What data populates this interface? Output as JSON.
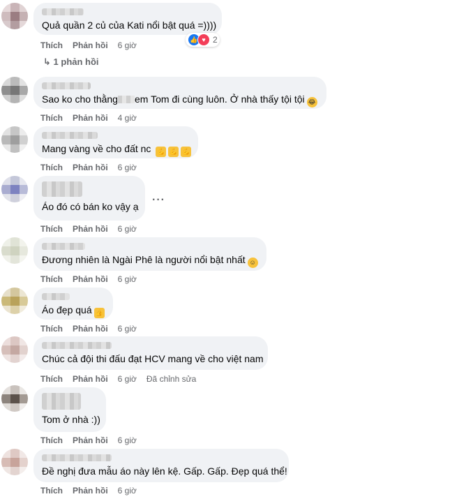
{
  "comments": [
    {
      "text": "Quả quần 2 củ của Kati nổi bật quá =))))",
      "like": "Thích",
      "reply": "Phản hồi",
      "time": "6 giờ",
      "reaction_count": "2",
      "replies_label": "1 phản hồi"
    },
    {
      "text_before": "Sao ko cho thằng",
      "text_after": "em Tom đi cùng luôn. Ở nhà thấy tội tội",
      "like": "Thích",
      "reply": "Phản hồi",
      "time": "4 giờ",
      "emoji": "rofl"
    },
    {
      "text": "Mang vàng về cho đất nc",
      "like": "Thích",
      "reply": "Phản hồi",
      "time": "6 giờ",
      "emoji": "flexed-biceps x3"
    },
    {
      "text": "Áo đó có bán ko vậy ạ",
      "like": "Thích",
      "reply": "Phản hồi",
      "time": "6 giờ"
    },
    {
      "text": "Đương nhiên là Ngài Phê là người nổi bật nhất",
      "like": "Thích",
      "reply": "Phản hồi",
      "time": "6 giờ",
      "emoji": "smile"
    },
    {
      "text": "Áo đẹp quá",
      "like": "Thích",
      "reply": "Phản hồi",
      "time": "6 giờ",
      "emoji": "thumbs-up"
    },
    {
      "text": "Chúc cả đội thi đấu đạt HCV mang về cho việt nam",
      "like": "Thích",
      "reply": "Phản hồi",
      "time": "6 giờ",
      "edited": "Đã chỉnh sửa"
    },
    {
      "text": "Tom ở nhà :))",
      "like": "Thích",
      "reply": "Phản hồi",
      "time": "6 giờ"
    },
    {
      "text": "Đề nghị đưa mẫu áo này lên kệ. Gấp. Gấp. Đẹp quá thể!",
      "like": "Thích",
      "reply": "Phản hồi",
      "time": "6 giờ"
    }
  ],
  "colors": {
    "bubble": "#f0f2f5",
    "meta": "#65676b",
    "like_blue": "#1877f2",
    "love_red": "#f33e58",
    "emoji_yellow": "#f7c23b"
  }
}
